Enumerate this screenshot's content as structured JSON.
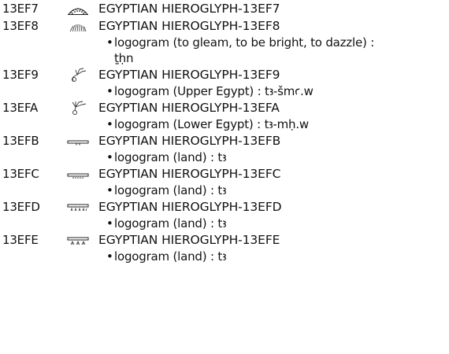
{
  "entries": [
    {
      "code": "13EF7",
      "glyph": "sunshine-rays-icon",
      "name": "EGYPTIAN HIEROGLYPH-13EF7",
      "notes": []
    },
    {
      "code": "13EF8",
      "glyph": "sunshine-rays-small-icon",
      "name": "EGYPTIAN HIEROGLYPH-13EF8",
      "notes": [
        {
          "text": "logogram (to gleam, to be bright, to dazzle) :",
          "cont": "ṯḥn"
        }
      ]
    },
    {
      "code": "13EF9",
      "glyph": "upper-egypt-plant-icon",
      "name": "EGYPTIAN HIEROGLYPH-13EF9",
      "notes": [
        {
          "text": "logogram (Upper Egypt) : tꜣ-šmꜥ.w",
          "cont": ""
        }
      ]
    },
    {
      "code": "13EFA",
      "glyph": "lower-egypt-plant-icon",
      "name": "EGYPTIAN HIEROGLYPH-13EFA",
      "notes": [
        {
          "text": "logogram (Lower Egypt) : tꜣ-mḥ.w",
          "cont": ""
        }
      ]
    },
    {
      "code": "13EFB",
      "glyph": "land-strip-icon",
      "name": "EGYPTIAN HIEROGLYPH-13EFB",
      "notes": [
        {
          "text": "logogram (land) : tꜣ",
          "cont": ""
        }
      ]
    },
    {
      "code": "13EFC",
      "glyph": "land-strip-dots-icon",
      "name": "EGYPTIAN HIEROGLYPH-13EFC",
      "notes": [
        {
          "text": "logogram (land) : tꜣ",
          "cont": ""
        }
      ]
    },
    {
      "code": "13EFD",
      "glyph": "land-strip-plants-icon",
      "name": "EGYPTIAN HIEROGLYPH-13EFD",
      "notes": [
        {
          "text": "logogram (land) : tꜣ",
          "cont": ""
        }
      ]
    },
    {
      "code": "13EFE",
      "glyph": "land-strip-sprouts-icon",
      "name": "EGYPTIAN HIEROGLYPH-13EFE",
      "notes": [
        {
          "text": "logogram (land) : tꜣ",
          "cont": ""
        }
      ]
    }
  ]
}
